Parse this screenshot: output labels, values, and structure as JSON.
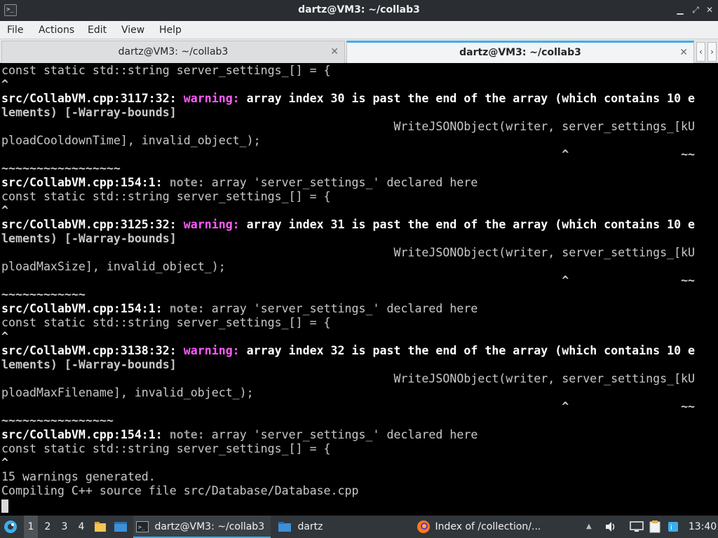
{
  "window": {
    "title": "dartz@VM3: ~/collab3"
  },
  "menu": [
    "File",
    "Actions",
    "Edit",
    "View",
    "Help"
  ],
  "tabs": [
    {
      "label": "dartz@VM3: ~/collab3",
      "active": false
    },
    {
      "label": "dartz@VM3: ~/collab3",
      "active": true
    }
  ],
  "terminal": {
    "l0": "const static std::string server_settings_[] = {",
    "l1": "^",
    "l2a": "src/CollabVM.cpp:3117:32: ",
    "l2b": "warning: ",
    "l2c": "array index 30 is past the end of the array (which contains 10 e",
    "l3": "lements) [-Warray-bounds]",
    "l4": "                                                        WriteJSONObject(writer, server_settings_[kU",
    "l5": "ploadCooldownTime], invalid_object_);",
    "l6a": "                                                                                ^",
    "l6b": "                ~~",
    "l7": "~~~~~~~~~~~~~~~~~",
    "l8a": "src/CollabVM.cpp:154:1: ",
    "l8b": "note: ",
    "l8c": "array 'server_settings_' declared here",
    "l9": "const static std::string server_settings_[] = {",
    "l10": "^",
    "l11a": "src/CollabVM.cpp:3125:32: ",
    "l11b": "warning: ",
    "l11c": "array index 31 is past the end of the array (which contains 10 e",
    "l12": "lements) [-Warray-bounds]",
    "l13": "                                                        WriteJSONObject(writer, server_settings_[kU",
    "l14": "ploadMaxSize], invalid_object_);",
    "l15a": "                                                                                ^",
    "l15b": "                ~~",
    "l16": "~~~~~~~~~~~~",
    "l17a": "src/CollabVM.cpp:154:1: ",
    "l17b": "note: ",
    "l17c": "array 'server_settings_' declared here",
    "l18": "const static std::string server_settings_[] = {",
    "l19": "^",
    "l20a": "src/CollabVM.cpp:3138:32: ",
    "l20b": "warning: ",
    "l20c": "array index 32 is past the end of the array (which contains 10 e",
    "l21": "lements) [-Warray-bounds]",
    "l22": "                                                        WriteJSONObject(writer, server_settings_[kU",
    "l23": "ploadMaxFilename], invalid_object_);",
    "l24a": "                                                                                ^",
    "l24b": "                ~~",
    "l25": "~~~~~~~~~~~~~~~~",
    "l26a": "src/CollabVM.cpp:154:1: ",
    "l26b": "note: ",
    "l26c": "array 'server_settings_' declared here",
    "l27": "const static std::string server_settings_[] = {",
    "l28": "^",
    "l29": "15 warnings generated.",
    "l30": "Compiling C++ source file src/Database/Database.cpp"
  },
  "taskbar": {
    "desktops": [
      "1",
      "2",
      "3",
      "4"
    ],
    "terminal_task": "dartz@VM3: ~/collab3",
    "folder_task": "dartz",
    "browser_task": "Index of /collection/...",
    "clock": "13:40"
  },
  "icons": {
    "app": "terminal-icon",
    "launcher": "kde-launcher-icon",
    "volume": "volume-icon",
    "network": "network-icon",
    "clipboard": "clipboard-icon",
    "updates": "update-notifier-icon"
  },
  "colors": {
    "accent": "#3daee9",
    "warning": "#ff5cff",
    "note": "#9a9a9a",
    "caret": "#55ff55"
  }
}
